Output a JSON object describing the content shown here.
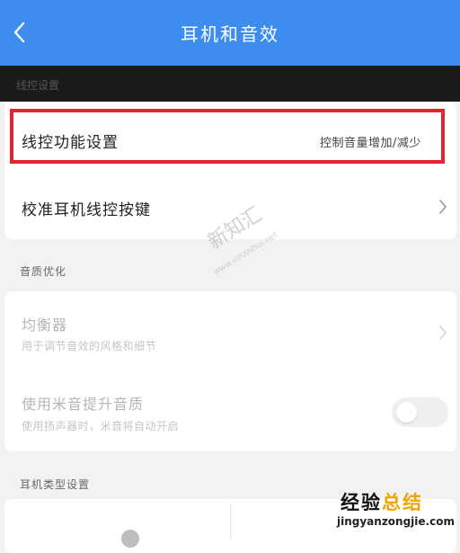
{
  "header": {
    "title": "耳机和音效"
  },
  "sections": {
    "remote": "线控设置",
    "sound_quality": "音质优化",
    "headphone_type": "耳机类型设置"
  },
  "remote_card": {
    "function_label": "线控功能设置",
    "function_value": "控制音量增加/减少",
    "calibrate_label": "校准耳机线控按键"
  },
  "quality_card": {
    "equalizer_title": "均衡器",
    "equalizer_sub": "用于调节音效的风格和细节",
    "mi_sound_title": "使用米音提升音质",
    "mi_sound_sub": "使用扬声器时，米音将自动开启",
    "mi_sound_on": false
  },
  "watermark": {
    "brand_left": "经验",
    "brand_right": "总结",
    "url": "jingyanzongjie.com",
    "faint_mark": "新知汇",
    "faint_url": "www.xinzhihui.net"
  },
  "colors": {
    "header_bg": "#3d8cf0",
    "highlight_border": "#e5262e",
    "watermark_accent": "#f0a500"
  }
}
